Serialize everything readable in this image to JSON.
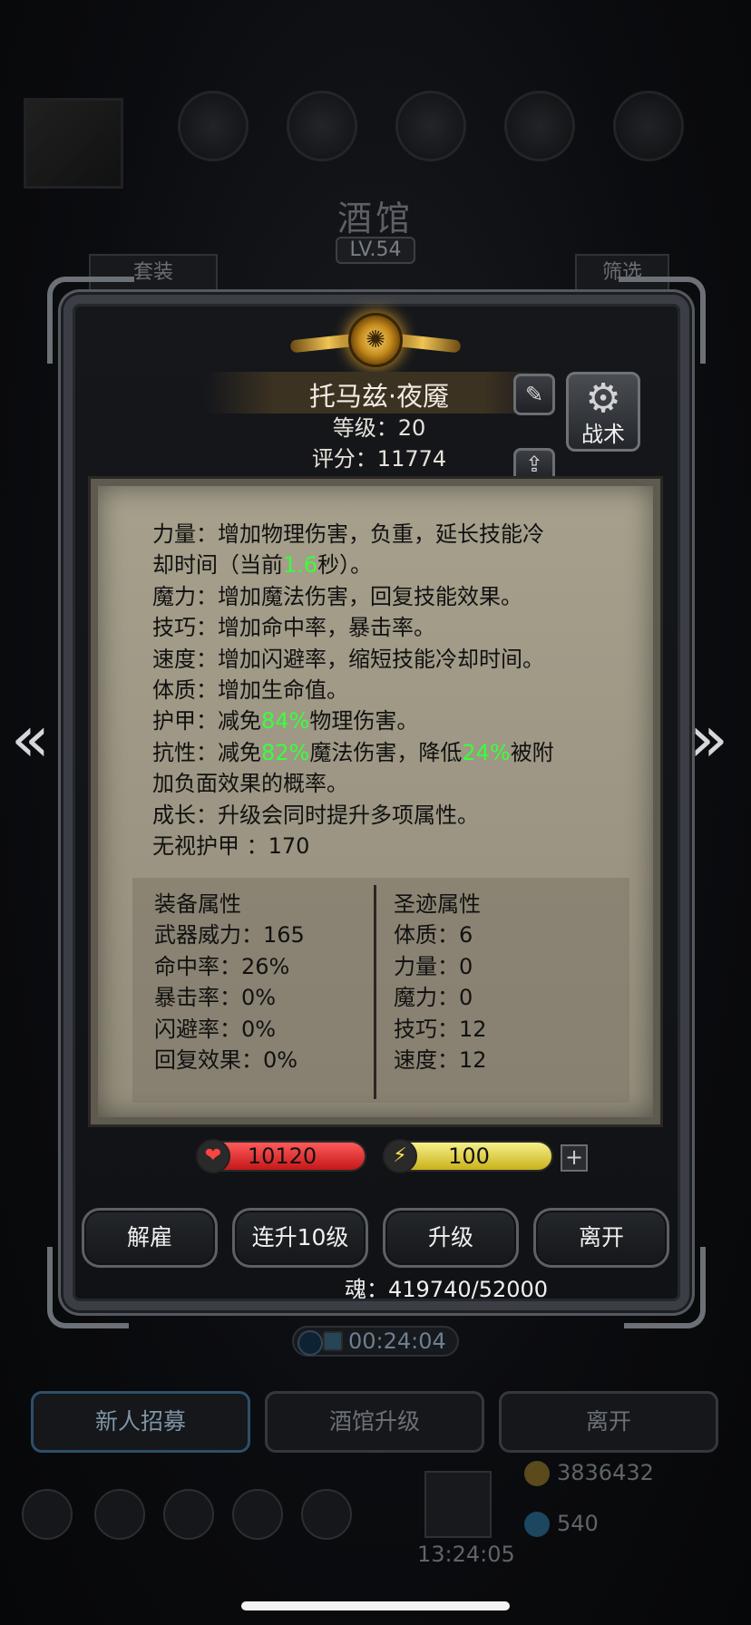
{
  "background": {
    "title": "酒馆",
    "level": "LV.54",
    "left_tab": "套装",
    "right_tab": "筛选",
    "timer": "00:24:04",
    "buttons": {
      "recruit": "新人招募",
      "upgrade": "酒馆升级",
      "leave": "离开"
    },
    "gold": "3836432",
    "gems": "540",
    "chest_timer": "13:24:05"
  },
  "hero": {
    "name": "托马兹·夜魇",
    "level_text": "等级：20",
    "score_text": "评分：11774",
    "tactics_label": "战术"
  },
  "description": {
    "strength_1": "力量：增加物理伤害，负重，延长技能冷",
    "strength_2a": "却时间（当前",
    "strength_value": "1.6",
    "strength_2b": "秒）。",
    "magic": "魔力：增加魔法伤害，回复技能效果。",
    "skill": "技巧：增加命中率，暴击率。",
    "speed": "速度：增加闪避率，缩短技能冷却时间。",
    "constitution": "体质：增加生命值。",
    "armor_a": "护甲：减免",
    "armor_value": "84%",
    "armor_b": "物理伤害。",
    "resist_a": "抗性：减免",
    "resist_value": "82%",
    "resist_b": "魔法伤害，降低",
    "resist_value2": "24%",
    "resist_c": "被附",
    "resist_2": "加负面效果的概率。",
    "growth": "成长：升级会同时提升多项属性。",
    "ignore_armor": "无视护甲 ：170"
  },
  "equipment_stats": {
    "title": "装备属性",
    "items": [
      "武器威力：165",
      "命中率：26%",
      "暴击率：0%",
      "闪避率：0%",
      "回复效果：0%"
    ]
  },
  "relic_stats": {
    "title": "圣迹属性",
    "items": [
      "体质：6",
      "力量：0",
      "魔力：0",
      "技巧：12",
      "速度：12"
    ]
  },
  "bars": {
    "hp": "10120",
    "energy": "100"
  },
  "actions": {
    "dismiss": "解雇",
    "level10": "连升10级",
    "levelup": "升级",
    "leave": "离开"
  },
  "soul": "魂：419740/52000",
  "icons": {
    "edit": "pencil-icon",
    "upload": "upload-icon",
    "tactics": "gear-icon",
    "hp": "heart-icon",
    "energy": "lightning-icon",
    "plus": "plus-icon",
    "prev": "chevron-left-icon",
    "next": "chevron-right-icon"
  }
}
